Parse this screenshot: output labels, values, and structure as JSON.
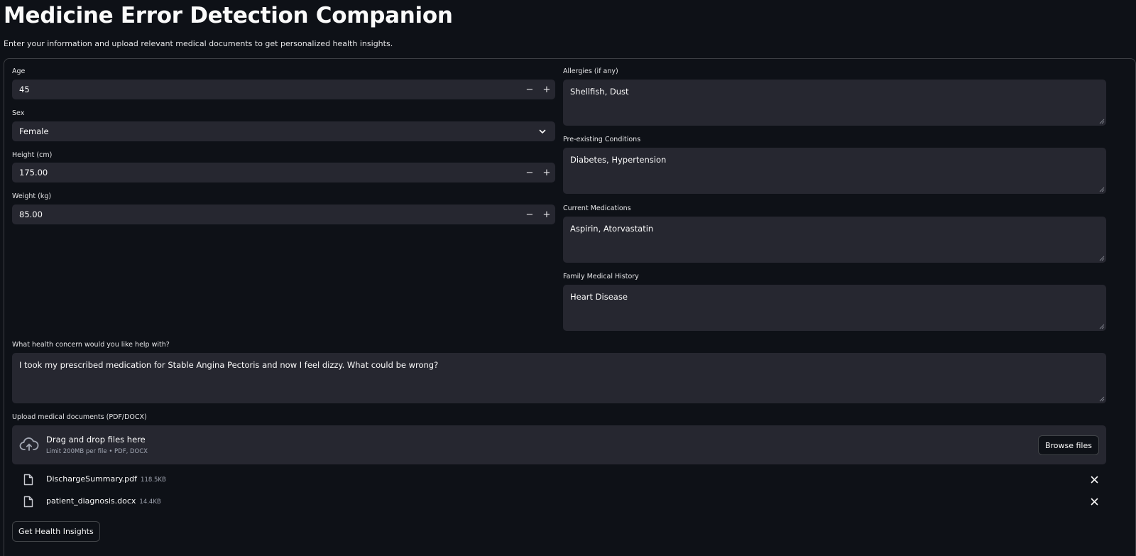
{
  "header": {
    "title": "Medicine Error Detection Companion",
    "subtitle": "Enter your information and upload relevant medical documents to get personalized health insights."
  },
  "form": {
    "age": {
      "label": "Age",
      "value": "45",
      "minus": "−",
      "plus": "+"
    },
    "sex": {
      "label": "Sex",
      "value": "Female"
    },
    "height": {
      "label": "Height (cm)",
      "value": "175.00",
      "minus": "−",
      "plus": "+"
    },
    "weight": {
      "label": "Weight (kg)",
      "value": "85.00",
      "minus": "−",
      "plus": "+"
    },
    "allergies": {
      "label": "Allergies (if any)",
      "value": "Shellfish, Dust"
    },
    "conditions": {
      "label": "Pre-existing Conditions",
      "value": "Diabetes, Hypertension"
    },
    "medications": {
      "label": "Current Medications",
      "value": "Aspirin, Atorvastatin"
    },
    "family_history": {
      "label": "Family Medical History",
      "value": "Heart Disease"
    },
    "concern": {
      "label": "What health concern would you like help with?",
      "value": "I took my prescribed medication for Stable Angina Pectoris and now I feel dizzy. What could be wrong?"
    }
  },
  "uploader": {
    "label": "Upload medical documents (PDF/DOCX)",
    "drop_text": "Drag and drop files here",
    "limit_text": "Limit 200MB per file • PDF, DOCX",
    "browse_label": "Browse files",
    "files": [
      {
        "name": "DischargeSummary.pdf",
        "size": "118.5KB"
      },
      {
        "name": "patient_diagnosis.docx",
        "size": "14.4KB"
      }
    ]
  },
  "actions": {
    "submit_label": "Get Health Insights"
  },
  "icons": {
    "upload": "cloud-upload-icon",
    "file": "file-icon",
    "remove": "close-icon",
    "select": "chevron-down-icon",
    "resize": "resize-handle-icon"
  },
  "colors": {
    "background": "#0e1117",
    "input_bg": "#262730",
    "text": "#fafafa",
    "muted_text": "#a3a8b4"
  }
}
